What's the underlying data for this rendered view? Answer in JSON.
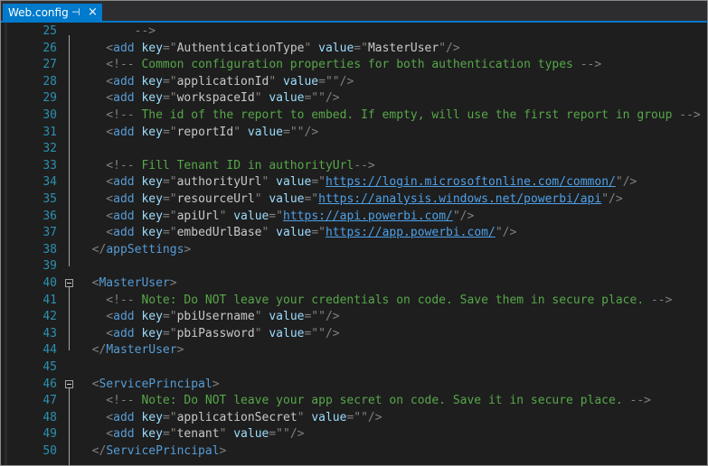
{
  "tab": {
    "title": "Web.config",
    "pin": "⊣",
    "close": "×"
  },
  "lines": [
    {
      "num": "25",
      "fold": "",
      "segments": [
        {
          "c": "br",
          "t": "        -->"
        }
      ]
    },
    {
      "num": "26",
      "fold": "",
      "segments": [
        {
          "c": "br",
          "t": "    <"
        },
        {
          "c": "tg",
          "t": "add"
        },
        {
          "c": "vl",
          "t": " "
        },
        {
          "c": "at",
          "t": "key"
        },
        {
          "c": "br",
          "t": "=\""
        },
        {
          "c": "vl",
          "t": "AuthenticationType"
        },
        {
          "c": "br",
          "t": "\" "
        },
        {
          "c": "at",
          "t": "value"
        },
        {
          "c": "br",
          "t": "=\""
        },
        {
          "c": "vl",
          "t": "MasterUser"
        },
        {
          "c": "br",
          "t": "\"/>"
        }
      ]
    },
    {
      "num": "27",
      "fold": "",
      "segments": [
        {
          "c": "br",
          "t": "    <!--"
        },
        {
          "c": "cm",
          "t": " Common configuration properties for both authentication types "
        },
        {
          "c": "br",
          "t": "-->"
        }
      ]
    },
    {
      "num": "28",
      "fold": "",
      "segments": [
        {
          "c": "br",
          "t": "    <"
        },
        {
          "c": "tg",
          "t": "add"
        },
        {
          "c": "vl",
          "t": " "
        },
        {
          "c": "at",
          "t": "key"
        },
        {
          "c": "br",
          "t": "=\""
        },
        {
          "c": "vl",
          "t": "applicationId"
        },
        {
          "c": "br",
          "t": "\" "
        },
        {
          "c": "at",
          "t": "value"
        },
        {
          "c": "br",
          "t": "=\"\"/>"
        }
      ]
    },
    {
      "num": "29",
      "fold": "",
      "segments": [
        {
          "c": "br",
          "t": "    <"
        },
        {
          "c": "tg",
          "t": "add"
        },
        {
          "c": "vl",
          "t": " "
        },
        {
          "c": "at",
          "t": "key"
        },
        {
          "c": "br",
          "t": "=\""
        },
        {
          "c": "vl",
          "t": "workspaceId"
        },
        {
          "c": "br",
          "t": "\" "
        },
        {
          "c": "at",
          "t": "value"
        },
        {
          "c": "br",
          "t": "=\"\"/>"
        }
      ]
    },
    {
      "num": "30",
      "fold": "",
      "segments": [
        {
          "c": "br",
          "t": "    <!--"
        },
        {
          "c": "cm",
          "t": " The id of the report to embed. If empty, will use the first report in group "
        },
        {
          "c": "br",
          "t": "-->"
        }
      ]
    },
    {
      "num": "31",
      "fold": "",
      "segments": [
        {
          "c": "br",
          "t": "    <"
        },
        {
          "c": "tg",
          "t": "add"
        },
        {
          "c": "vl",
          "t": " "
        },
        {
          "c": "at",
          "t": "key"
        },
        {
          "c": "br",
          "t": "=\""
        },
        {
          "c": "vl",
          "t": "reportId"
        },
        {
          "c": "br",
          "t": "\" "
        },
        {
          "c": "at",
          "t": "value"
        },
        {
          "c": "br",
          "t": "=\"\"/>"
        }
      ]
    },
    {
      "num": "32",
      "fold": "",
      "segments": []
    },
    {
      "num": "33",
      "fold": "",
      "segments": [
        {
          "c": "br",
          "t": "    <!--"
        },
        {
          "c": "cm",
          "t": " Fill Tenant ID in authorityUrl"
        },
        {
          "c": "br",
          "t": "-->"
        }
      ]
    },
    {
      "num": "34",
      "fold": "",
      "segments": [
        {
          "c": "br",
          "t": "    <"
        },
        {
          "c": "tg",
          "t": "add"
        },
        {
          "c": "vl",
          "t": " "
        },
        {
          "c": "at",
          "t": "key"
        },
        {
          "c": "br",
          "t": "=\""
        },
        {
          "c": "vl",
          "t": "authorityUrl"
        },
        {
          "c": "br",
          "t": "\" "
        },
        {
          "c": "at",
          "t": "value"
        },
        {
          "c": "br",
          "t": "=\""
        },
        {
          "c": "ln2",
          "t": "https://login.microsoftonline.com/common/"
        },
        {
          "c": "br",
          "t": "\"/>"
        }
      ]
    },
    {
      "num": "35",
      "fold": "",
      "segments": [
        {
          "c": "br",
          "t": "    <"
        },
        {
          "c": "tg",
          "t": "add"
        },
        {
          "c": "vl",
          "t": " "
        },
        {
          "c": "at",
          "t": "key"
        },
        {
          "c": "br",
          "t": "=\""
        },
        {
          "c": "vl",
          "t": "resourceUrl"
        },
        {
          "c": "br",
          "t": "\" "
        },
        {
          "c": "at",
          "t": "value"
        },
        {
          "c": "br",
          "t": "=\""
        },
        {
          "c": "ln2",
          "t": "https://analysis.windows.net/powerbi/api"
        },
        {
          "c": "br",
          "t": "\"/>"
        }
      ]
    },
    {
      "num": "36",
      "fold": "",
      "segments": [
        {
          "c": "br",
          "t": "    <"
        },
        {
          "c": "tg",
          "t": "add"
        },
        {
          "c": "vl",
          "t": " "
        },
        {
          "c": "at",
          "t": "key"
        },
        {
          "c": "br",
          "t": "=\""
        },
        {
          "c": "vl",
          "t": "apiUrl"
        },
        {
          "c": "br",
          "t": "\" "
        },
        {
          "c": "at",
          "t": "value"
        },
        {
          "c": "br",
          "t": "=\""
        },
        {
          "c": "ln2",
          "t": "https://api.powerbi.com/"
        },
        {
          "c": "br",
          "t": "\"/>"
        }
      ]
    },
    {
      "num": "37",
      "fold": "",
      "segments": [
        {
          "c": "br",
          "t": "    <"
        },
        {
          "c": "tg",
          "t": "add"
        },
        {
          "c": "vl",
          "t": " "
        },
        {
          "c": "at",
          "t": "key"
        },
        {
          "c": "br",
          "t": "=\""
        },
        {
          "c": "vl",
          "t": "embedUrlBase"
        },
        {
          "c": "br",
          "t": "\" "
        },
        {
          "c": "at",
          "t": "value"
        },
        {
          "c": "br",
          "t": "=\""
        },
        {
          "c": "ln2",
          "t": "https://app.powerbi.com/"
        },
        {
          "c": "br",
          "t": "\"/>"
        }
      ]
    },
    {
      "num": "38",
      "fold": "",
      "segments": [
        {
          "c": "br",
          "t": "  </"
        },
        {
          "c": "tg",
          "t": "appSettings"
        },
        {
          "c": "br",
          "t": ">"
        }
      ]
    },
    {
      "num": "39",
      "fold": "",
      "segments": []
    },
    {
      "num": "40",
      "fold": "open",
      "segments": [
        {
          "c": "br",
          "t": "  <"
        },
        {
          "c": "tg",
          "t": "MasterUser"
        },
        {
          "c": "br",
          "t": ">"
        }
      ]
    },
    {
      "num": "41",
      "fold": "",
      "segments": [
        {
          "c": "br",
          "t": "    <!--"
        },
        {
          "c": "cm",
          "t": " Note: Do NOT leave your credentials on code. Save them in secure place. "
        },
        {
          "c": "br",
          "t": "-->"
        }
      ]
    },
    {
      "num": "42",
      "fold": "",
      "segments": [
        {
          "c": "br",
          "t": "    <"
        },
        {
          "c": "tg",
          "t": "add"
        },
        {
          "c": "vl",
          "t": " "
        },
        {
          "c": "at",
          "t": "key"
        },
        {
          "c": "br",
          "t": "=\""
        },
        {
          "c": "vl",
          "t": "pbiUsername"
        },
        {
          "c": "br",
          "t": "\" "
        },
        {
          "c": "at",
          "t": "value"
        },
        {
          "c": "br",
          "t": "=\"\"/>"
        }
      ]
    },
    {
      "num": "43",
      "fold": "",
      "segments": [
        {
          "c": "br",
          "t": "    <"
        },
        {
          "c": "tg",
          "t": "add"
        },
        {
          "c": "vl",
          "t": " "
        },
        {
          "c": "at",
          "t": "key"
        },
        {
          "c": "br",
          "t": "=\""
        },
        {
          "c": "vl",
          "t": "pbiPassword"
        },
        {
          "c": "br",
          "t": "\" "
        },
        {
          "c": "at",
          "t": "value"
        },
        {
          "c": "br",
          "t": "=\"\"/>"
        }
      ]
    },
    {
      "num": "44",
      "fold": "",
      "segments": [
        {
          "c": "br",
          "t": "  </"
        },
        {
          "c": "tg",
          "t": "MasterUser"
        },
        {
          "c": "br",
          "t": ">"
        }
      ]
    },
    {
      "num": "45",
      "fold": "",
      "segments": []
    },
    {
      "num": "46",
      "fold": "open",
      "segments": [
        {
          "c": "br",
          "t": "  <"
        },
        {
          "c": "tg",
          "t": "ServicePrincipal"
        },
        {
          "c": "br",
          "t": ">"
        }
      ]
    },
    {
      "num": "47",
      "fold": "",
      "segments": [
        {
          "c": "br",
          "t": "    <!--"
        },
        {
          "c": "cm",
          "t": " Note: Do NOT leave your app secret on code. Save it in secure place. "
        },
        {
          "c": "br",
          "t": "-->"
        }
      ]
    },
    {
      "num": "48",
      "fold": "",
      "segments": [
        {
          "c": "br",
          "t": "    <"
        },
        {
          "c": "tg",
          "t": "add"
        },
        {
          "c": "vl",
          "t": " "
        },
        {
          "c": "at",
          "t": "key"
        },
        {
          "c": "br",
          "t": "=\""
        },
        {
          "c": "vl",
          "t": "applicationSecret"
        },
        {
          "c": "br",
          "t": "\" "
        },
        {
          "c": "at",
          "t": "value"
        },
        {
          "c": "br",
          "t": "=\"\"/>"
        }
      ]
    },
    {
      "num": "49",
      "fold": "",
      "segments": [
        {
          "c": "br",
          "t": "    <"
        },
        {
          "c": "tg",
          "t": "add"
        },
        {
          "c": "vl",
          "t": " "
        },
        {
          "c": "at",
          "t": "key"
        },
        {
          "c": "br",
          "t": "=\""
        },
        {
          "c": "vl",
          "t": "tenant"
        },
        {
          "c": "br",
          "t": "\" "
        },
        {
          "c": "at",
          "t": "value"
        },
        {
          "c": "br",
          "t": "=\"\"/>"
        }
      ]
    },
    {
      "num": "50",
      "fold": "",
      "segments": [
        {
          "c": "br",
          "t": "  </"
        },
        {
          "c": "tg",
          "t": "ServicePrincipal"
        },
        {
          "c": "br",
          "t": ">"
        }
      ]
    }
  ]
}
